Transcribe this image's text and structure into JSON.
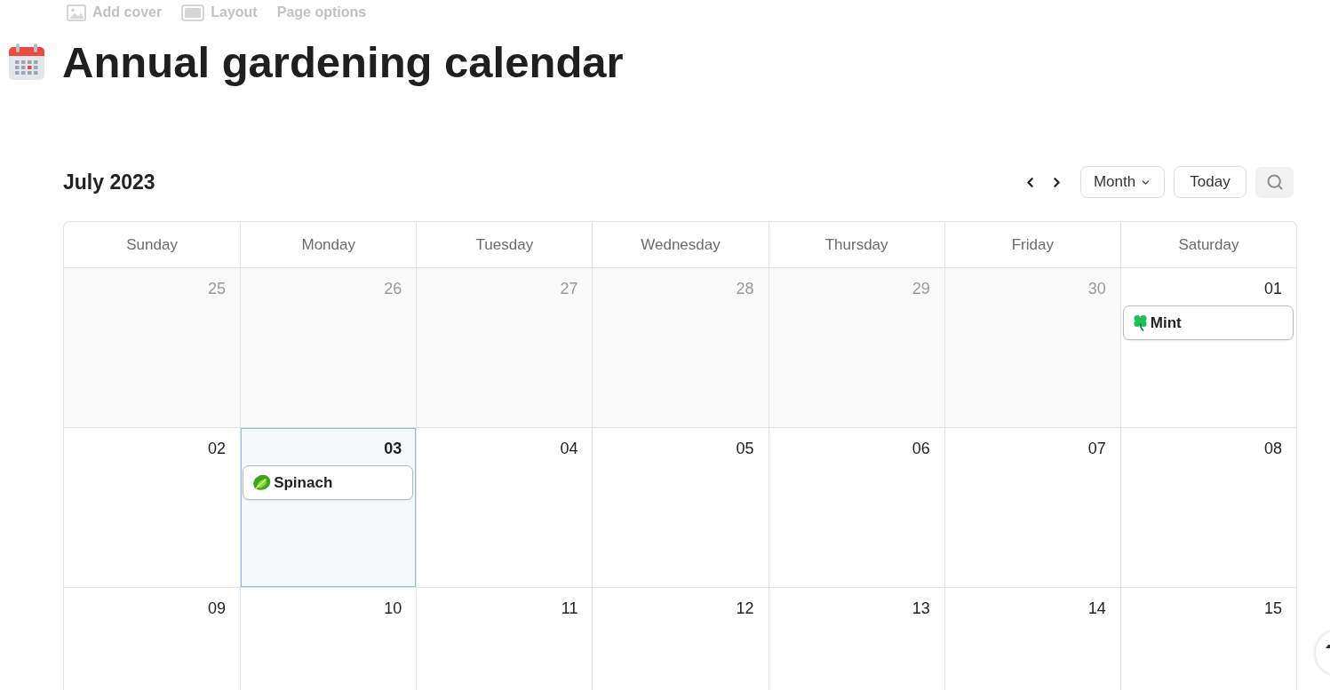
{
  "page_actions": [
    {
      "kind": "image",
      "label": "Add cover"
    },
    {
      "kind": "layout",
      "label": "Layout"
    },
    {
      "kind": "text",
      "label": "Page options"
    }
  ],
  "title": "Annual gardening calendar",
  "calendar": {
    "period": "July 2023",
    "view": "Month",
    "today_button": "Today",
    "weekdays": [
      "Sunday",
      "Monday",
      "Tuesday",
      "Wednesday",
      "Thursday",
      "Friday",
      "Saturday"
    ],
    "weeks": [
      {
        "days": [
          {
            "day": "25",
            "outside_month": true,
            "today": false
          },
          {
            "day": "26",
            "outside_month": true,
            "today": false
          },
          {
            "day": "27",
            "outside_month": true,
            "today": false
          },
          {
            "day": "28",
            "outside_month": true,
            "today": false
          },
          {
            "day": "29",
            "outside_month": true,
            "today": false
          },
          {
            "day": "30",
            "outside_month": true,
            "today": false
          },
          {
            "day": "01",
            "outside_month": false,
            "today": false,
            "events": [
              {
                "kind": "clover",
                "name": "Mint"
              }
            ]
          }
        ]
      },
      {
        "days": [
          {
            "day": "02",
            "outside_month": false,
            "today": false
          },
          {
            "day": "03",
            "outside_month": false,
            "today": true,
            "events": [
              {
                "kind": "leaf",
                "name": "Spinach"
              }
            ]
          },
          {
            "day": "04",
            "outside_month": false,
            "today": false
          },
          {
            "day": "05",
            "outside_month": false,
            "today": false
          },
          {
            "day": "06",
            "outside_month": false,
            "today": false
          },
          {
            "day": "07",
            "outside_month": false,
            "today": false
          },
          {
            "day": "08",
            "outside_month": false,
            "today": false
          }
        ]
      },
      {
        "days": [
          {
            "day": "09",
            "outside_month": false,
            "today": false
          },
          {
            "day": "10",
            "outside_month": false,
            "today": false
          },
          {
            "day": "11",
            "outside_month": false,
            "today": false
          },
          {
            "day": "12",
            "outside_month": false,
            "today": false
          },
          {
            "day": "13",
            "outside_month": false,
            "today": false
          },
          {
            "day": "14",
            "outside_month": false,
            "today": false
          },
          {
            "day": "15",
            "outside_month": false,
            "today": false
          }
        ]
      }
    ]
  }
}
